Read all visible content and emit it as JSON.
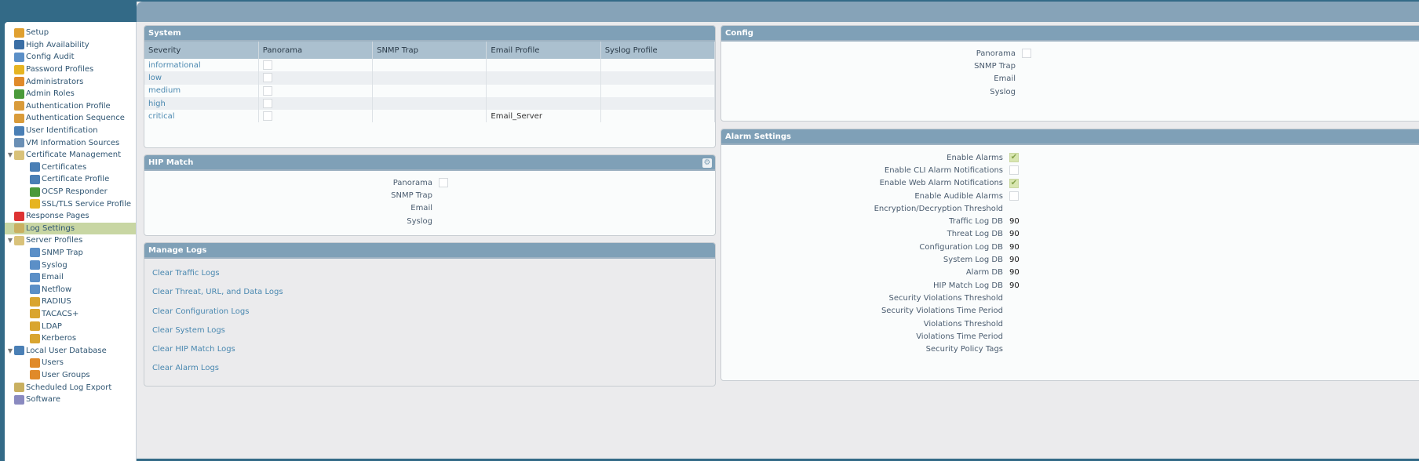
{
  "sidebar": {
    "items": [
      {
        "label": "Setup",
        "level": 0,
        "icon": "setup-icon"
      },
      {
        "label": "High Availability",
        "level": 0,
        "icon": "ha-icon"
      },
      {
        "label": "Config Audit",
        "level": 0,
        "icon": "audit-icon"
      },
      {
        "label": "Password Profiles",
        "level": 0,
        "icon": "key-icon"
      },
      {
        "label": "Administrators",
        "level": 0,
        "icon": "user-icon"
      },
      {
        "label": "Admin Roles",
        "level": 0,
        "icon": "role-icon"
      },
      {
        "label": "Authentication Profile",
        "level": 0,
        "icon": "auth-icon"
      },
      {
        "label": "Authentication Sequence",
        "level": 0,
        "icon": "auth-seq-icon"
      },
      {
        "label": "User Identification",
        "level": 0,
        "icon": "id-card-icon"
      },
      {
        "label": "VM Information Sources",
        "level": 0,
        "icon": "vm-icon"
      },
      {
        "label": "Certificate Management",
        "level": 0,
        "icon": "folder-icon",
        "expand": "▼"
      },
      {
        "label": "Certificates",
        "level": 1,
        "icon": "cert-icon"
      },
      {
        "label": "Certificate Profile",
        "level": 1,
        "icon": "cert-icon"
      },
      {
        "label": "OCSP Responder",
        "level": 1,
        "icon": "ocsp-icon"
      },
      {
        "label": "SSL/TLS Service Profile",
        "level": 1,
        "icon": "lock-icon"
      },
      {
        "label": "Response Pages",
        "level": 0,
        "icon": "response-icon"
      },
      {
        "label": "Log Settings",
        "level": 0,
        "icon": "log-icon",
        "selected": true
      },
      {
        "label": "Server Profiles",
        "level": 0,
        "icon": "folder-icon",
        "expand": "▼"
      },
      {
        "label": "SNMP Trap",
        "level": 1,
        "icon": "server-icon"
      },
      {
        "label": "Syslog",
        "level": 1,
        "icon": "server-icon"
      },
      {
        "label": "Email",
        "level": 1,
        "icon": "server-icon"
      },
      {
        "label": "Netflow",
        "level": 1,
        "icon": "server-icon"
      },
      {
        "label": "RADIUS",
        "level": 1,
        "icon": "server-lock-icon"
      },
      {
        "label": "TACACS+",
        "level": 1,
        "icon": "server-lock-icon"
      },
      {
        "label": "LDAP",
        "level": 1,
        "icon": "server-lock-icon"
      },
      {
        "label": "Kerberos",
        "level": 1,
        "icon": "server-lock-icon"
      },
      {
        "label": "Local User Database",
        "level": 0,
        "icon": "id-card-icon",
        "expand": "▼"
      },
      {
        "label": "Users",
        "level": 1,
        "icon": "user-icon"
      },
      {
        "label": "User Groups",
        "level": 1,
        "icon": "group-icon"
      },
      {
        "label": "Scheduled Log Export",
        "level": 0,
        "icon": "export-icon"
      },
      {
        "label": "Software",
        "level": 0,
        "icon": "software-icon"
      }
    ]
  },
  "system": {
    "title": "System",
    "columns": [
      "Severity",
      "Panorama",
      "SNMP Trap",
      "Email Profile",
      "Syslog Profile"
    ],
    "rows": [
      {
        "severity": "informational",
        "panorama": false,
        "snmp": "",
        "email": "",
        "syslog": ""
      },
      {
        "severity": "low",
        "panorama": false,
        "snmp": "",
        "email": "",
        "syslog": ""
      },
      {
        "severity": "medium",
        "panorama": false,
        "snmp": "",
        "email": "",
        "syslog": ""
      },
      {
        "severity": "high",
        "panorama": false,
        "snmp": "",
        "email": "",
        "syslog": ""
      },
      {
        "severity": "critical",
        "panorama": false,
        "snmp": "",
        "email": "Email_Server",
        "syslog": ""
      }
    ]
  },
  "hip": {
    "title": "HIP Match",
    "panorama": "Panorama",
    "snmp": "SNMP Trap",
    "email": "Email",
    "syslog": "Syslog"
  },
  "manage": {
    "title": "Manage Logs",
    "links": [
      "Clear Traffic Logs",
      "Clear Threat, URL, and Data Logs",
      "Clear Configuration Logs",
      "Clear System Logs",
      "Clear HIP Match Logs",
      "Clear Alarm Logs"
    ]
  },
  "config": {
    "title": "Config",
    "panorama": "Panorama",
    "snmp": "SNMP Trap",
    "email": "Email",
    "syslog": "Syslog"
  },
  "alarm": {
    "title": "Alarm Settings",
    "rows": [
      {
        "label": "Enable Alarms",
        "type": "check",
        "checked": true
      },
      {
        "label": "Enable CLI Alarm Notifications",
        "type": "check",
        "checked": false
      },
      {
        "label": "Enable Web Alarm Notifications",
        "type": "check",
        "checked": true
      },
      {
        "label": "Enable Audible Alarms",
        "type": "check",
        "checked": false
      },
      {
        "label": "Encryption/Decryption Threshold",
        "type": "text",
        "value": ""
      },
      {
        "label": "Traffic Log DB",
        "type": "text",
        "value": "90"
      },
      {
        "label": "Threat Log DB",
        "type": "text",
        "value": "90"
      },
      {
        "label": "Configuration Log DB",
        "type": "text",
        "value": "90"
      },
      {
        "label": "System Log DB",
        "type": "text",
        "value": "90"
      },
      {
        "label": "Alarm DB",
        "type": "text",
        "value": "90"
      },
      {
        "label": "HIP Match Log DB",
        "type": "text",
        "value": "90"
      },
      {
        "label": "Security Violations Threshold",
        "type": "text",
        "value": ""
      },
      {
        "label": "Security Violations Time Period",
        "type": "text",
        "value": ""
      },
      {
        "label": "Violations Threshold",
        "type": "text",
        "value": ""
      },
      {
        "label": "Violations Time Period",
        "type": "text",
        "value": ""
      },
      {
        "label": "Security Policy Tags",
        "type": "text",
        "value": ""
      }
    ]
  }
}
